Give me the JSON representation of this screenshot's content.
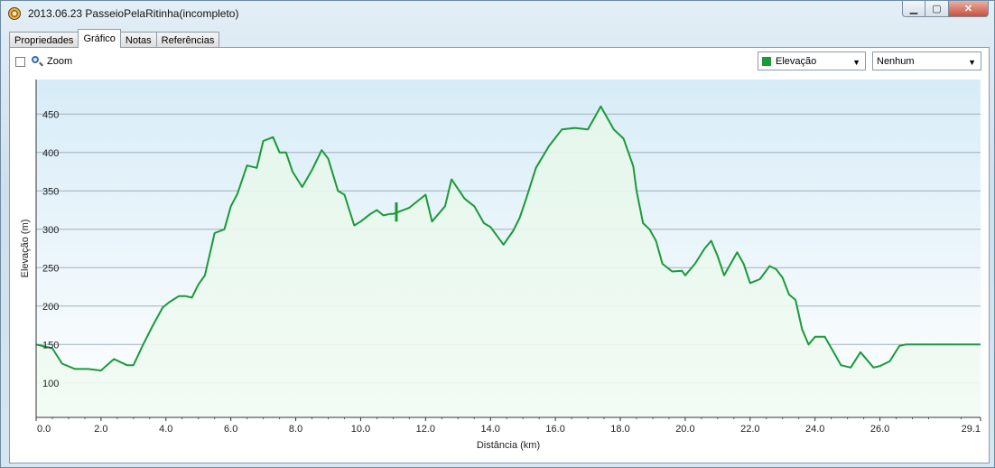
{
  "window": {
    "title": "2013.06.23 PasseioPelaRitinha(incompleto)",
    "controls": {
      "minimize": "▁",
      "maximize": "▢",
      "close": "✕"
    }
  },
  "tabs": [
    {
      "label": "Propriedades",
      "active": false
    },
    {
      "label": "Gráfico",
      "active": true
    },
    {
      "label": "Notas",
      "active": false
    },
    {
      "label": "Referências",
      "active": false
    }
  ],
  "toolbar": {
    "zoom_label": "Zoom",
    "zoom_checked": false,
    "series_select": {
      "value": "Elevação",
      "color": "#1a9a3a"
    },
    "second_select": {
      "value": "Nenhum"
    }
  },
  "chart_data": {
    "type": "area",
    "xlabel": "Distância  (km)",
    "ylabel": "Elevação (m)",
    "xlim": [
      0,
      29.1
    ],
    "ylim": [
      55,
      495
    ],
    "x_ticks": [
      "0.0",
      "2.0",
      "4.0",
      "6.0",
      "8.0",
      "10.0",
      "12.0",
      "14.0",
      "16.0",
      "18.0",
      "20.0",
      "22.0",
      "24.0",
      "26.0",
      "29.1"
    ],
    "y_ticks": [
      100,
      150,
      200,
      250,
      300,
      350,
      400,
      450
    ],
    "grid": true,
    "line_color": "#1a9a3a",
    "series": [
      {
        "x": [
          0,
          0.5,
          0.8,
          1.2,
          1.6,
          2.0,
          2.1,
          2.4,
          2.8,
          3.0,
          3.3,
          3.6,
          3.9,
          4.1,
          4.4,
          4.6,
          4.8,
          5.0,
          5.2,
          5.5,
          5.8,
          6.0,
          6.2,
          6.5,
          6.8,
          7.0,
          7.3,
          7.5,
          7.7,
          7.9,
          8.2,
          8.5,
          8.8,
          9.0,
          9.3,
          9.5,
          9.8,
          10.0,
          10.3,
          10.5,
          10.7,
          10.9,
          11.0,
          11.5,
          12.0,
          12.2,
          12.6,
          12.8,
          13.2,
          13.5,
          13.8,
          14.0,
          14.4,
          14.7,
          14.9,
          15.1,
          15.4,
          15.8,
          16.2,
          16.6,
          17.0,
          17.4,
          17.8,
          18.1,
          18.4,
          18.5,
          18.7,
          18.9,
          19.1,
          19.3,
          19.6,
          19.9,
          20.0,
          20.3,
          20.6,
          20.8,
          21.0,
          21.2,
          21.6,
          21.8,
          22.0,
          22.3,
          22.6,
          22.8,
          23.0,
          23.2,
          23.4,
          23.6,
          23.8,
          24.0,
          24.3,
          24.6,
          24.8,
          25.1,
          25.4,
          25.8,
          26.0,
          26.3,
          26.6,
          26.8,
          27.0,
          27.2,
          27.4,
          27.6,
          27.8,
          28.0,
          28.2,
          28.4,
          28.6,
          28.8,
          29.1
        ],
        "y": [
          150,
          145,
          125,
          118,
          118,
          116,
          120,
          131,
          123,
          123,
          150,
          175,
          198,
          205,
          213,
          213,
          211,
          228,
          240,
          295,
          300,
          330,
          346,
          383,
          380,
          415,
          420,
          400,
          400,
          375,
          355,
          377,
          403,
          392,
          350,
          345,
          305,
          310,
          320,
          325,
          318,
          320,
          320,
          328,
          345,
          310,
          330,
          365,
          340,
          330,
          308,
          303,
          280,
          298,
          315,
          340,
          380,
          408,
          430,
          432,
          430,
          460,
          430,
          418,
          382,
          350,
          308,
          300,
          285,
          255,
          245,
          246,
          240,
          255,
          275,
          285,
          265,
          240,
          270,
          255,
          230,
          235,
          252,
          248,
          237,
          215,
          208,
          170,
          150,
          160,
          160,
          138,
          123,
          120,
          140,
          120,
          122,
          128,
          148,
          150,
          150,
          150,
          150,
          150,
          150,
          150,
          150,
          150,
          150,
          150,
          150
        ],
        "name": "Elevação"
      }
    ]
  }
}
